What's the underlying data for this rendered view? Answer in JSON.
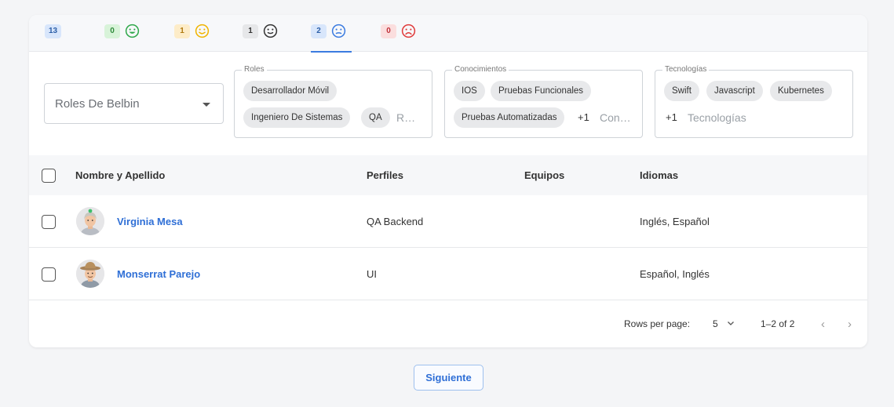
{
  "tabs": [
    {
      "count": "13",
      "face": null,
      "bg": "#d8e6fb",
      "fg": "#2d5fa8",
      "icon_color": null
    },
    {
      "count": "0",
      "face": "happy",
      "bg": "#d8f3d9",
      "fg": "#2e8b3a",
      "icon_color": "#2fa84a"
    },
    {
      "count": "1",
      "face": "smile",
      "bg": "#fdecc8",
      "fg": "#b07a10",
      "icon_color": "#f0b400"
    },
    {
      "count": "1",
      "face": "neutral",
      "bg": "#e6e7e9",
      "fg": "#333333",
      "icon_color": "#333333"
    },
    {
      "count": "2",
      "face": "meh",
      "bg": "#d8e6fb",
      "fg": "#2d5fa8",
      "icon_color": "#3b7be0",
      "active": true
    },
    {
      "count": "0",
      "face": "sad",
      "bg": "#fbdede",
      "fg": "#c0303a",
      "icon_color": "#e03b3b"
    }
  ],
  "filters": {
    "belbin": {
      "placeholder": "Roles De Belbin"
    },
    "roles": {
      "legend": "Roles",
      "chips": [
        "Desarrollador Móvil",
        "Ingeniero De Sistemas",
        "QA"
      ],
      "placeholder": "R…"
    },
    "conocimientos": {
      "legend": "Conocimientos",
      "chips": [
        "IOS",
        "Pruebas Funcionales",
        "Pruebas Automatizadas"
      ],
      "more": "+1",
      "placeholder": "Con…"
    },
    "tecnologias": {
      "legend": "Tecnologías",
      "chips": [
        "Swift",
        "Javascript",
        "Kubernetes"
      ],
      "more": "+1",
      "placeholder": "Tecnologías"
    }
  },
  "table": {
    "headers": [
      "Nombre y Apellido",
      "Perfiles",
      "Equipos",
      "Idiomas"
    ],
    "rows": [
      {
        "name": "Virginia Mesa",
        "perfiles": "QA Backend",
        "equipos": "",
        "idiomas": "Inglés, Español"
      },
      {
        "name": "Monserrat Parejo",
        "perfiles": "UI",
        "equipos": "",
        "idiomas": "Español, Inglés"
      }
    ]
  },
  "pagination": {
    "rows_label": "Rows per page:",
    "rows_value": "5",
    "range": "1–2 of 2"
  },
  "next_button": "Siguiente",
  "colors": {
    "accent": "#3b7be0",
    "link": "#2f6fd6"
  }
}
